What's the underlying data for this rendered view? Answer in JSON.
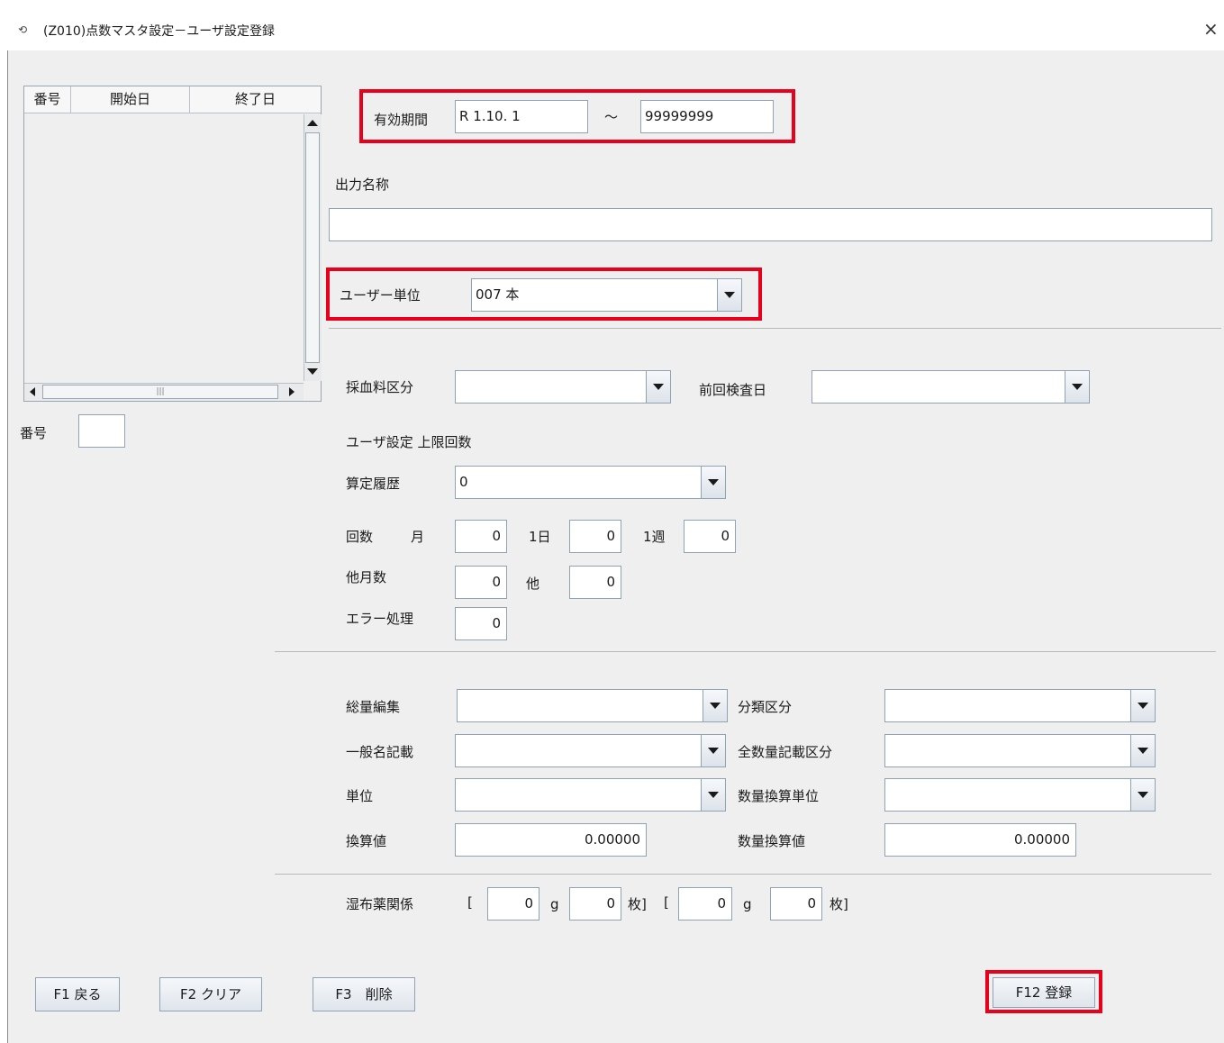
{
  "window": {
    "title": "(Z010)点数マスタ設定－ユーザ設定登録",
    "close_label": "×"
  },
  "table": {
    "headers": [
      "番号",
      "開始日",
      "終了日"
    ],
    "rows": []
  },
  "number_label": "番号",
  "number_value": "",
  "period": {
    "label": "有効期間",
    "start": "R 1.10. 1",
    "tilde": "～",
    "end": "99999999"
  },
  "output_name": {
    "label": "出力名称",
    "value": ""
  },
  "user_unit": {
    "label": "ユーザー単位",
    "value": "007 本"
  },
  "blood_fee": {
    "label": "採血料区分",
    "value": ""
  },
  "prev_exam": {
    "label": "前回検査日",
    "value": ""
  },
  "user_limit_label": "ユーザ設定  上限回数",
  "calc_history": {
    "label": "算定履歴",
    "value": "0"
  },
  "count": {
    "label": "回数",
    "month_label": "月",
    "month_value": "0",
    "day_label": "1日",
    "day_value": "0",
    "week_label": "1週",
    "week_value": "0"
  },
  "other_months": {
    "label": "他月数",
    "value": "0",
    "other_label": "他",
    "other_value": "0"
  },
  "error_proc": {
    "label": "エラー処理",
    "value": "0"
  },
  "total_edit": {
    "label": "総量編集",
    "value": ""
  },
  "class_div": {
    "label": "分類区分",
    "value": ""
  },
  "generic_name": {
    "label": "一般名記載",
    "value": ""
  },
  "all_qty": {
    "label": "全数量記載区分",
    "value": ""
  },
  "unit": {
    "label": "単位",
    "value": ""
  },
  "qty_conv_unit": {
    "label": "数量換算単位",
    "value": ""
  },
  "conv_value": {
    "label": "換算値",
    "value": "0.00000"
  },
  "qty_conv_value": {
    "label": "数量換算値",
    "value": "0.00000"
  },
  "poultice": {
    "label": "湿布薬関係",
    "open1": "[",
    "g1": "0",
    "g_label1": "g",
    "sheets1": "0",
    "sheets_label1": "枚]",
    "open2": "[",
    "g2": "0",
    "g_label2": "g",
    "sheets2": "0",
    "sheets_label2": "枚]"
  },
  "buttons": {
    "back": "F1 戻る",
    "clear": "F2 クリア",
    "delete": "F3　削除",
    "register": "F12 登録"
  }
}
